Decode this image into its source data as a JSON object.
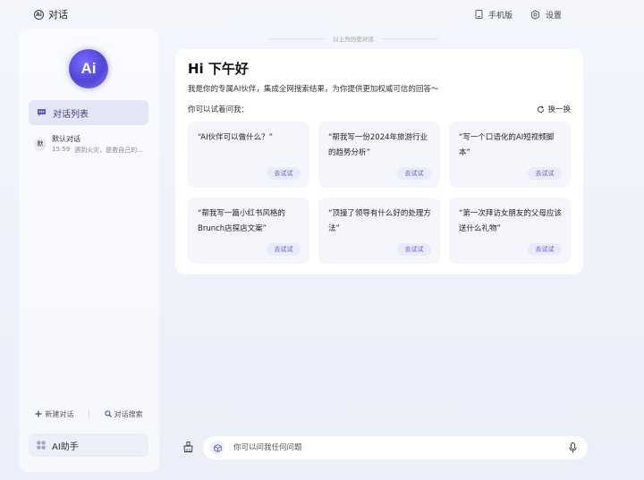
{
  "app": {
    "title": "对话",
    "logo_text": "Ai"
  },
  "topbar": {
    "mobile_label": "手机版",
    "settings_label": "设置"
  },
  "sidebar": {
    "avatar_text": "Ai",
    "nav_active_label": "对话列表",
    "conversation": {
      "badge": "默",
      "title": "默认对话",
      "time": "15:59",
      "preview": "遇到火灾，是救自己的..."
    },
    "new_chat_label": "新建对话",
    "search_chat_label": "对话搜索",
    "assistant_label": "AI助手"
  },
  "history_label": "以上为历史对话",
  "welcome": {
    "greeting": "Hi 下午好",
    "intro": "我是你的专属AI伙伴，集成全网搜索结果，为你提供更加权威可信的回答～",
    "try_label": "你可以试着问我：",
    "refresh_label": "换一换",
    "cards": [
      {
        "text": "“AI伙伴可以做什么？”",
        "button": "去试试"
      },
      {
        "text": "“帮我写一份2024年旅游行业的趋势分析”",
        "button": "去试试"
      },
      {
        "text": "“写一个口语化的AI短视频脚本”",
        "button": "去试试"
      },
      {
        "text": "“帮我写一篇小红书风格的Brunch店探店文案”",
        "button": "去试试"
      },
      {
        "text": "“顶撞了领导有什么好的处理方法”",
        "button": "去试试"
      },
      {
        "text": "“第一次拜访女朋友的父母应该送什么礼物”",
        "button": "去试试"
      }
    ]
  },
  "input": {
    "placeholder": "你可以问我任何问题"
  },
  "colors": {
    "accent": "#5a5fc0",
    "background": "#f0f2fa"
  }
}
